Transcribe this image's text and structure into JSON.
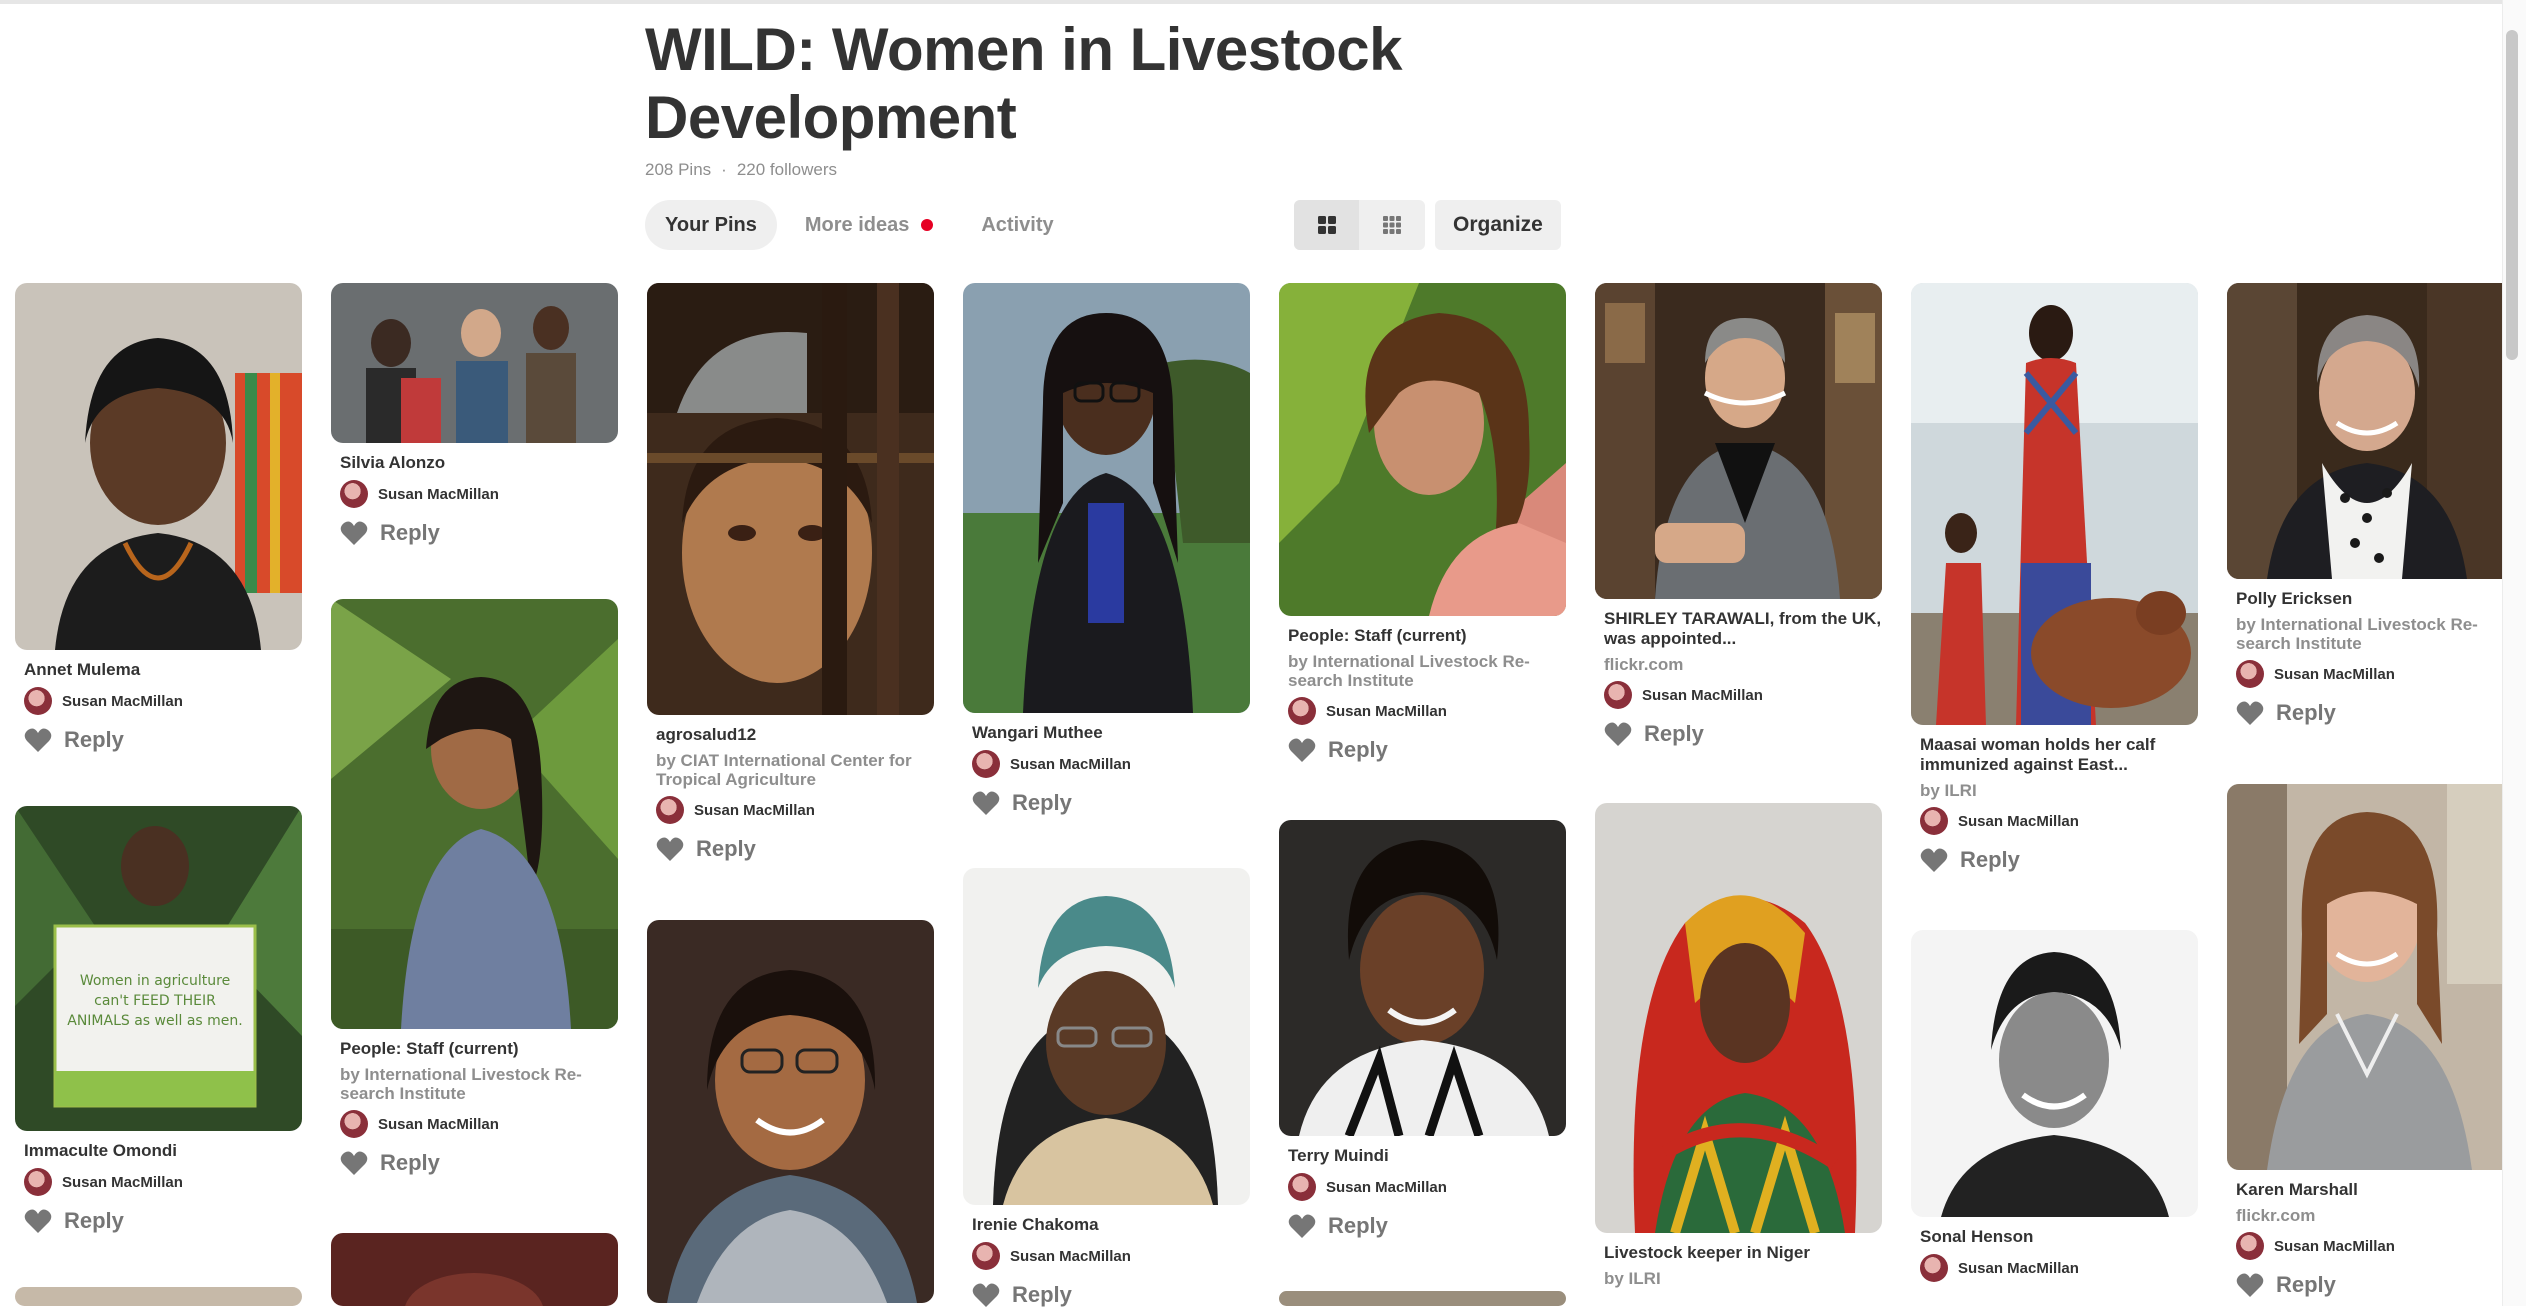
{
  "board": {
    "title": "WILD: Women in Livestock Development",
    "pins_count": "208 Pins",
    "dot": "·",
    "followers": "220 followers"
  },
  "tabs": [
    {
      "label": "Your Pins",
      "active": true
    },
    {
      "label": "More ideas",
      "has_notification": true
    },
    {
      "label": "Activity"
    }
  ],
  "view_toggle": {
    "options": [
      "grid-large-icon",
      "grid-small-icon"
    ],
    "selected": "grid-large-icon"
  },
  "organize_label": "Organize",
  "colors": {
    "notification_dot": "#e60023",
    "text": "#333333",
    "muted": "#8e8e8e"
  },
  "user": "Susan MacMillan",
  "reply_label": "Reply",
  "pins": [
    {
      "title": "Annet Mulema",
      "source": ""
    },
    {
      "title": "Immaculte Omondi",
      "source": ""
    },
    {
      "title": "",
      "source": ""
    },
    {
      "title": "Silvia Alonzo",
      "source": ""
    },
    {
      "title": "People: Staff (current)",
      "source": "by International Livestock Re-search Institute"
    },
    {
      "title": "",
      "source": ""
    },
    {
      "title": "agrosalud12",
      "source": "by CIAT International Center for Tropical Agriculture"
    },
    {
      "title": "",
      "source": ""
    },
    {
      "title": "Wangari Muthee",
      "source": ""
    },
    {
      "title": "Irenie Chakoma",
      "source": ""
    },
    {
      "title": "People: Staff (current)",
      "source": "by International Livestock Re-search Institute"
    },
    {
      "title": "Terry Muindi",
      "source": ""
    },
    {
      "title": "",
      "source": ""
    },
    {
      "title": "SHIRLEY TARAWALI, from the UK, was appointed...",
      "source": "flickr.com"
    },
    {
      "title": "Livestock keeper in Niger",
      "source": "by ILRI"
    },
    {
      "title": "Maasai woman holds her calf immunized against East...",
      "source": "by ILRI"
    },
    {
      "title": "Sonal Henson",
      "source": ""
    },
    {
      "title": "Polly Ericksen",
      "source": "by International Livestock Re-search Institute"
    },
    {
      "title": "Karen Marshall",
      "source": "flickr.com"
    }
  ],
  "image_labels": {
    "immaculte_sign_text": "Women in agriculture can't FEED THEIR ANIMALS as well as men."
  }
}
